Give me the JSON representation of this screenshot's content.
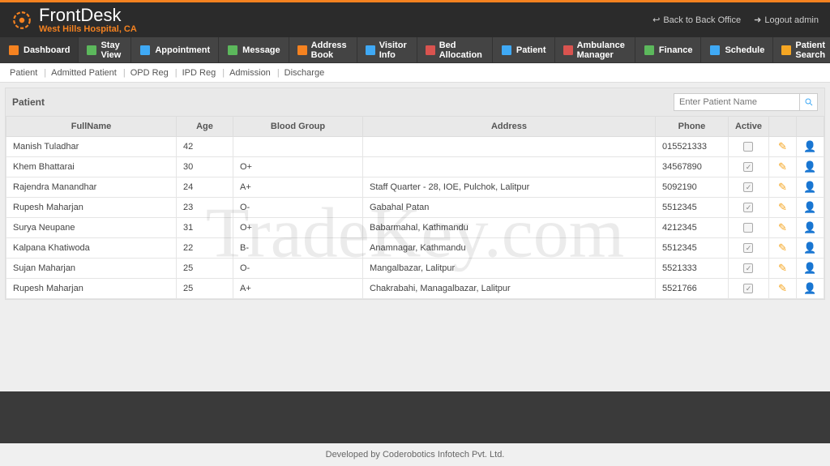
{
  "brand": {
    "name": "FrontDesk",
    "location": "West Hills Hospital, CA"
  },
  "top_links": {
    "back": "Back to Back Office",
    "logout": "Logout admin"
  },
  "nav": [
    {
      "label": "Dashboard",
      "icon": "home-icon",
      "color": "#f58220"
    },
    {
      "label": "Stay View",
      "icon": "bed-icon",
      "color": "#5cb85c"
    },
    {
      "label": "Appointment",
      "icon": "calendar-icon",
      "color": "#3fa9f5"
    },
    {
      "label": "Message",
      "icon": "message-icon",
      "color": "#5cb85c"
    },
    {
      "label": "Address Book",
      "icon": "book-icon",
      "color": "#f58220"
    },
    {
      "label": "Visitor Info",
      "icon": "visitor-icon",
      "color": "#3fa9f5"
    },
    {
      "label": "Bed Allocation",
      "icon": "bed-alloc-icon",
      "color": "#d9534f"
    },
    {
      "label": "Patient",
      "icon": "patient-icon",
      "color": "#3fa9f5"
    },
    {
      "label": "Ambulance Manager",
      "icon": "ambulance-icon",
      "color": "#d9534f"
    },
    {
      "label": "Finance",
      "icon": "finance-icon",
      "color": "#5cb85c"
    },
    {
      "label": "Schedule",
      "icon": "schedule-icon",
      "color": "#3fa9f5"
    },
    {
      "label": "Patient Search",
      "icon": "search-icon",
      "color": "#f5a623"
    }
  ],
  "subnav": [
    "Patient",
    "Admitted Patient",
    "OPD Reg",
    "IPD Reg",
    "Admission",
    "Discharge"
  ],
  "panel": {
    "title": "Patient",
    "search_placeholder": "Enter Patient Name"
  },
  "columns": {
    "name": "FullName",
    "age": "Age",
    "blood": "Blood Group",
    "address": "Address",
    "phone": "Phone",
    "active": "Active"
  },
  "rows": [
    {
      "name": "Manish Tuladhar",
      "age": "42",
      "blood": "",
      "address": "",
      "phone": "015521333",
      "active": false
    },
    {
      "name": "Khem Bhattarai",
      "age": "30",
      "blood": "O+",
      "address": "",
      "phone": "34567890",
      "active": true
    },
    {
      "name": "Rajendra Manandhar",
      "age": "24",
      "blood": "A+",
      "address": "Staff Quarter - 28, IOE, Pulchok, Lalitpur",
      "phone": "5092190",
      "active": true
    },
    {
      "name": "Rupesh Maharjan",
      "age": "23",
      "blood": "O-",
      "address": "Gabahal Patan",
      "phone": "5512345",
      "active": true
    },
    {
      "name": "Surya Neupane",
      "age": "31",
      "blood": "O+",
      "address": "Babarmahal, Kathmandu",
      "phone": "4212345",
      "active": false
    },
    {
      "name": "Kalpana Khatiwoda",
      "age": "22",
      "blood": "B-",
      "address": "Anamnagar, Kathmandu",
      "phone": "5512345",
      "active": true
    },
    {
      "name": "Sujan Maharjan",
      "age": "25",
      "blood": "O-",
      "address": "Mangalbazar, Lalitpur",
      "phone": "5521333",
      "active": true
    },
    {
      "name": "Rupesh Maharjan",
      "age": "25",
      "blood": "A+",
      "address": "Chakrabahi, Managalbazar, Lalitpur",
      "phone": "5521766",
      "active": true
    }
  ],
  "footer": "Developed by Coderobotics Infotech Pvt. Ltd.",
  "watermark": "TradeKey.com"
}
